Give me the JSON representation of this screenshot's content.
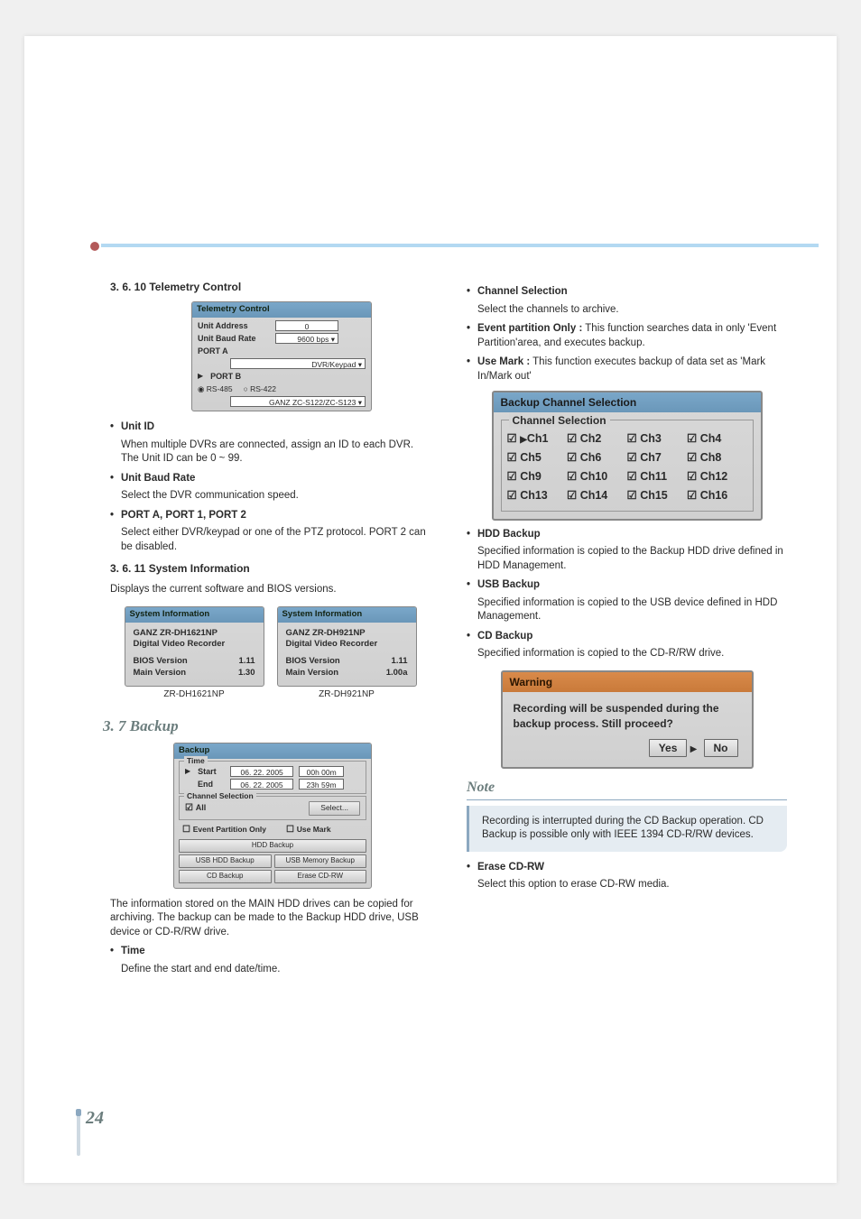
{
  "page_number": "24",
  "left": {
    "h_telemetry": "3. 6. 10 Telemetry Control",
    "telemetry_panel": {
      "title": "Telemetry Control",
      "unit_address_lbl": "Unit Address",
      "unit_address_val": "0",
      "unit_baud_lbl": "Unit Baud Rate",
      "unit_baud_val": "9600 bps",
      "porta": "PORT A",
      "porta_val": "DVR/Keypad",
      "portb": "PORT B",
      "rs485": "RS-485",
      "rs422": "RS-422",
      "portb_val": "GANZ ZC-S122/ZC-S123"
    },
    "unit_id_t": "Unit ID",
    "unit_id_b": "When multiple DVRs are connected, assign an ID to each DVR.  The Unit ID can be 0 ~ 99.",
    "unit_baud_t": "Unit Baud Rate",
    "unit_baud_b": "Select the DVR communication speed.",
    "port_t": "PORT A, PORT 1, PORT 2",
    "port_b": "Select either DVR/keypad or one of the PTZ protocol.  PORT 2 can be disabled.",
    "h_sysinfo": "3. 6. 11 System Information",
    "sysinfo_body": "Displays the current software and BIOS versions.",
    "sys1": {
      "title": "System Information",
      "l1": "GANZ ZR-DH1621NP",
      "l2": "Digital Video Recorder",
      "bios_l": "BIOS Version",
      "bios_v": "1.11",
      "main_l": "Main Version",
      "main_v": "1.30",
      "cap": "ZR-DH1621NP"
    },
    "sys2": {
      "title": "System Information",
      "l1": "GANZ ZR-DH921NP",
      "l2": "Digital Video Recorder",
      "bios_l": "BIOS Version",
      "bios_v": "1.11",
      "main_l": "Main Version",
      "main_v": "1.00a",
      "cap": "ZR-DH921NP"
    },
    "h_backup": "3. 7 Backup",
    "backup_panel": {
      "title": "Backup",
      "time_g": "Time",
      "start_l": "Start",
      "start_d": "06. 22. 2005",
      "start_t": "00h 00m",
      "end_l": "End",
      "end_d": "06. 22. 2005",
      "end_t": "23h 59m",
      "cs_g": "Channel Selection",
      "all": "All",
      "select": "Select...",
      "epo": "Event Partition Only",
      "um": "Use Mark",
      "hdd": "HDD Backup",
      "usb_hdd": "USB HDD Backup",
      "usb_mem": "USB Memory Backup",
      "cd": "CD Backup",
      "erase": "Erase CD-RW"
    },
    "backup_body": "The information stored on the MAIN HDD drives can be copied for archiving. The backup can be made to the Backup HDD drive, USB device or CD-R/RW drive.",
    "time_t": "Time",
    "time_b": "Define the start and end date/time."
  },
  "right": {
    "cs_t": "Channel Selection",
    "cs_b": "Select the channels to archive.",
    "epo_t": "Event partition Only :",
    "epo_b": " This function searches data in only 'Event Partition'area, and executes backup.",
    "um_t": "Use Mark :",
    "um_b": " This function executes backup of data set as 'Mark In/Mark out'",
    "bcs": {
      "title": "Backup Channel Selection",
      "group": "Channel Selection",
      "ch": [
        "Ch1",
        "Ch2",
        "Ch3",
        "Ch4",
        "Ch5",
        "Ch6",
        "Ch7",
        "Ch8",
        "Ch9",
        "Ch10",
        "Ch11",
        "Ch12",
        "Ch13",
        "Ch14",
        "Ch15",
        "Ch16"
      ]
    },
    "hdd_t": "HDD Backup",
    "hdd_b": "Specified information is copied to the Backup HDD drive defined in HDD Management.",
    "usb_t": "USB Backup",
    "usb_b": "Specified information is copied to the USB device defined in HDD Management.",
    "cd_t": "CD Backup",
    "cd_b": "Specified information is copied to the CD-R/RW drive.",
    "warn": {
      "title": "Warning",
      "body": "Recording will be suspended during the backup process. Still proceed?",
      "yes": "Yes",
      "no": "No"
    },
    "note_h": "Note",
    "note_b": "Recording is interrupted during the CD Backup operation. CD Backup is possible only with IEEE 1394 CD-R/RW devices.",
    "erase_t": "Erase CD-RW",
    "erase_b": "Select this option to erase CD-RW media."
  }
}
